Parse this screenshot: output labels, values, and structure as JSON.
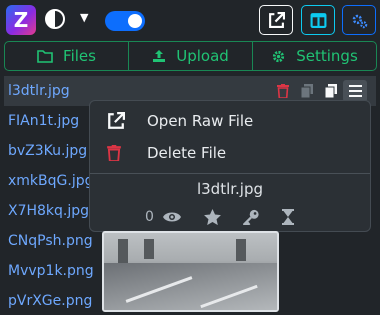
{
  "logo": {
    "letter": "Z"
  },
  "nav": {
    "files_label": "Files",
    "upload_label": "Upload",
    "settings_label": "Settings"
  },
  "files": [
    "l3dtlr.jpg",
    "FIAn1t.jpg",
    "bvZ3Ku.jpg",
    "xmkBqG.jpg",
    "X7H8kq.jpg",
    "CNqPsh.png",
    "Mvvp1k.png",
    "pVrXGe.png"
  ],
  "context_menu": {
    "open_raw_label": "Open Raw File",
    "delete_label": "Delete File",
    "file_name": "l3dtlr.jpg",
    "view_count": "0"
  },
  "colors": {
    "accent": "#0d6efd",
    "success": "#198754",
    "danger": "#dc3545",
    "info": "#0dcaf0"
  }
}
